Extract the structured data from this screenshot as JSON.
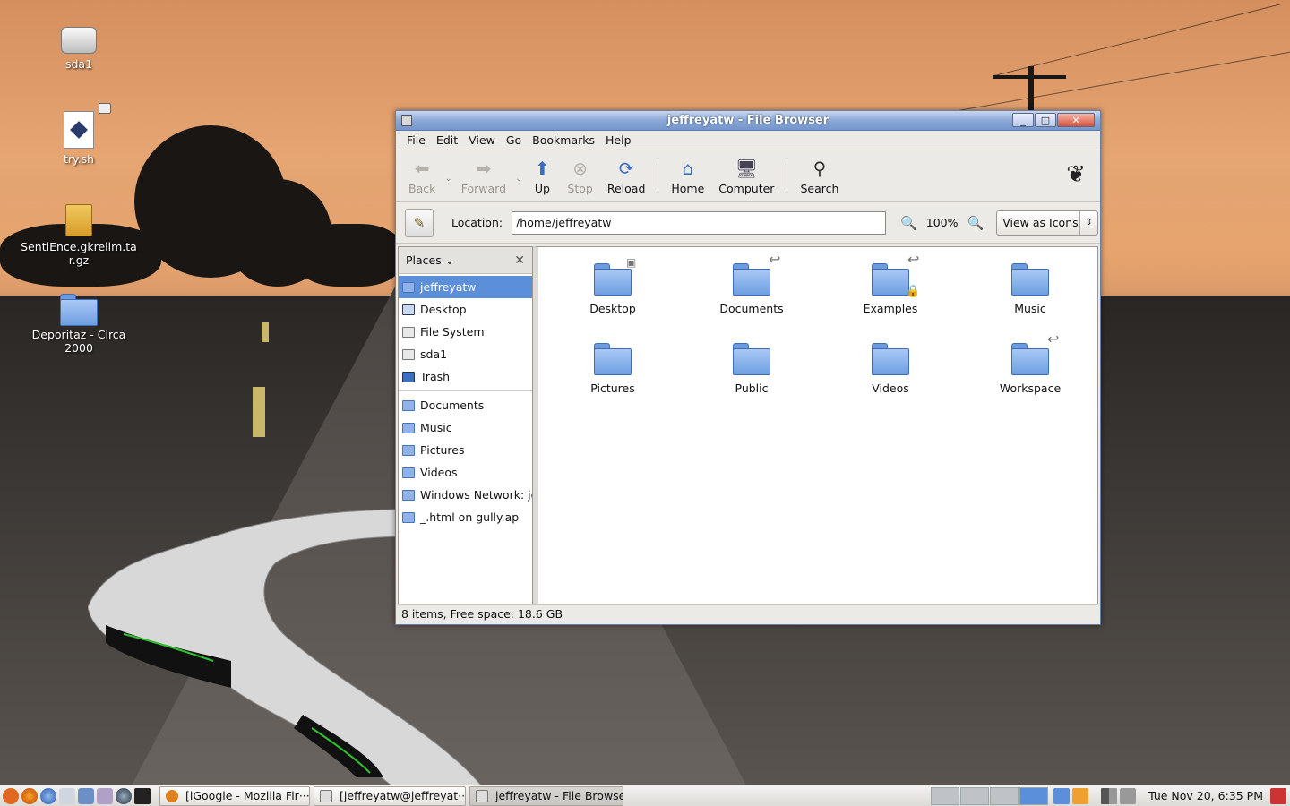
{
  "desktop": {
    "icons": [
      {
        "label": "sda1",
        "icon": "drive-icon"
      },
      {
        "label": "try.sh",
        "icon": "script-icon"
      },
      {
        "label": "SentiEnce.gkrellm.tar.gz",
        "icon": "archive-icon"
      },
      {
        "label": "Deporitaz - Circa 2000",
        "icon": "folder-icon"
      }
    ]
  },
  "window": {
    "title": "jeffreyatw - File Browser",
    "menu": [
      "File",
      "Edit",
      "View",
      "Go",
      "Bookmarks",
      "Help"
    ],
    "toolbar": {
      "back": "Back",
      "forward": "Forward",
      "up": "Up",
      "stop": "Stop",
      "reload": "Reload",
      "home": "Home",
      "computer": "Computer",
      "search": "Search"
    },
    "location": {
      "label": "Location:",
      "value": "/home/jeffreyatw",
      "zoom": "100%",
      "view_mode": "View as Icons"
    },
    "sidebar": {
      "header": "Places",
      "items": [
        {
          "label": "jeffreyatw",
          "icon": "home-folder-icon"
        },
        {
          "label": "Desktop",
          "icon": "desktop-icon"
        },
        {
          "label": "File System",
          "icon": "drive-icon"
        },
        {
          "label": "sda1",
          "icon": "drive-icon"
        },
        {
          "label": "Trash",
          "icon": "trash-icon"
        }
      ],
      "bookmarks": [
        {
          "label": "Documents"
        },
        {
          "label": "Music"
        },
        {
          "label": "Pictures"
        },
        {
          "label": "Videos"
        },
        {
          "label": "Windows Network: jeff"
        },
        {
          "label": "_.html on gully.ap"
        }
      ]
    },
    "files": [
      {
        "label": "Desktop"
      },
      {
        "label": "Documents"
      },
      {
        "label": "Examples"
      },
      {
        "label": "Music"
      },
      {
        "label": "Pictures"
      },
      {
        "label": "Public"
      },
      {
        "label": "Videos"
      },
      {
        "label": "Workspace"
      }
    ],
    "status": "8 items, Free space: 18.6 GB"
  },
  "taskbar": {
    "tasks": [
      {
        "label": "[iGoogle - Mozilla Fir···"
      },
      {
        "label": "[jeffreyatw@jeffreyat···"
      },
      {
        "label": "jeffreyatw - File Browser"
      }
    ],
    "clock": "Tue Nov 20,  6:35 PM"
  }
}
